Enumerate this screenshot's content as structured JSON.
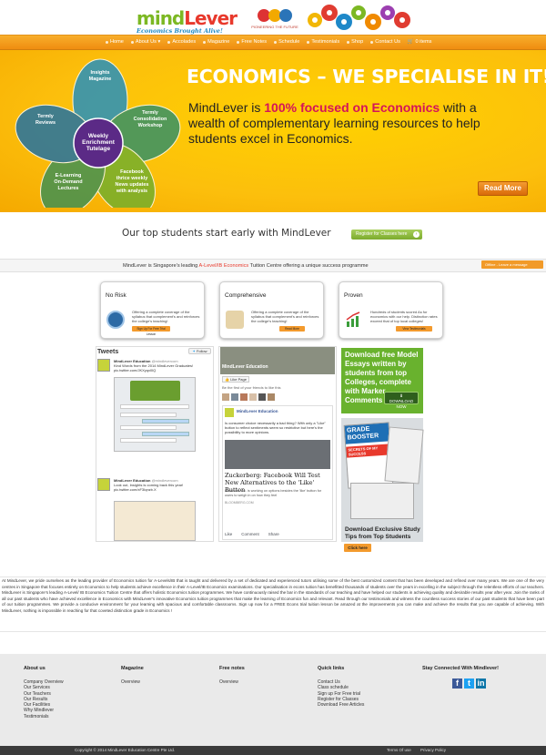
{
  "header": {
    "logo_mind": "mind",
    "logo_lever": "Lever",
    "logo_tagline": "Economics Brought Alive!",
    "sponsor_text": "PIONEERING THE FUTURE"
  },
  "nav": {
    "items": [
      "Home",
      "About Us",
      "Accolades",
      "Magazine",
      "Free Notes",
      "Schedule",
      "Testimonials",
      "Shop",
      "Contact Us",
      "0 items"
    ]
  },
  "hero": {
    "title": "ECONOMICS – WE SPECIALISE IN IT!",
    "body_pre": "MindLever is ",
    "body_highlight": "100% focused on Economics",
    "body_post": " with a wealth of complementary learning resources to help students excel in Economics.",
    "read_more": "Read More",
    "venn": {
      "center": "Weekly Enrichment Tutelage",
      "petals": [
        "Insights Magazine",
        "Termly Consolidation Workshop",
        "Facebook thrice weekly News updates with analysis",
        "E-Learning On-Demand Lectures",
        "Termly Reviews"
      ]
    }
  },
  "early": {
    "text": "Our top students start early with MindLever",
    "register": "Register for Classes here"
  },
  "leading": {
    "pre": "MindLever is Singapore's leading ",
    "highlight": "A-Level/IB Economics",
    "post": " Tuition Centre offering a unique success programme",
    "offline": "Offline - Leave a message"
  },
  "boxes": [
    {
      "title": "No Risk",
      "text": "Offering a complete coverage of the syllabus that complement's and reinforces the college's teaching!",
      "button": "Sign Up For Free Trial Lesson"
    },
    {
      "title": "Comprehensive",
      "text": "Offering a complete coverage of the syllabus that complement's and reinforces the college's teaching!",
      "button": "Read More"
    },
    {
      "title": "Proven",
      "text": "Hundreds of students scored As for economics with our help. Distinction rates exceed that of top local colleges!",
      "button": "View Testimonials"
    }
  ],
  "tweets": {
    "header": "Tweets",
    "follow": "Follow",
    "items": [
      {
        "author": "MindLever Education",
        "handle": "@mindlevercom",
        "text": "Kind Words from the 2014 MindLever Graduates! pic.twitter.com/JKXyqxl0Q"
      },
      {
        "author": "MindLever Education",
        "handle": "@mindlevercom",
        "text": "Look out, Insights is coming back this year! pic.twitter.com/xF3Iqnzb.X"
      }
    ]
  },
  "facebook": {
    "page": "MindLever Education",
    "like": "Like Page",
    "friends": "Be the first of your friends to like this",
    "post_text": "Is consumer choice necessarily a bad thing? With only a \"Like\" button to reflect sentiments seem so restrictive but here's the possibility to more opinions.",
    "article_title": "Zuckerberg: Facebook Will Test New Alternatives to the 'Like' Button",
    "article_text": "Facebook Inc. is working on options besides the 'like' button for users to weigh in on how they feel",
    "source": "BLOOMBERG.COM",
    "actions": [
      "Like",
      "Comment",
      "Share"
    ]
  },
  "promo": {
    "text": "Download free Model Essays written by students from top Colleges, complete with Marker Comments",
    "button": "DOWNLOAD NOW"
  },
  "grade": {
    "title": "GRADE BOOSTER",
    "subtitle": "SECRETS OF MY SUCCESS",
    "caption": "Download Exclusive Study Tips from Top Students",
    "click": "Click here"
  },
  "paragraph": "At MindLever, we pride ourselves as the leading provider of Economics tuition for A-Levels/IB that is taught and delivered by a set of dedicated and experienced tutors utilising some of the best customized content that has been developed and refined over many years. We are one of the very centres in Singapore that focuses entirely on Economics to help students achieve excellence in their A-Level/IB Economics examinations. Our specialisation in econs tuition has benefitted thousands of students over the years in excelling in the subject through the relentless efforts of our teachers. MindLever is Singapore's leading A-Level/ IB Economics Tuition Centre that offers holistic Economics tuition programmes. We have continuously raised the bar in the standards of our teaching and have helped our students in achieving quality and desirable results year after year. Join the ranks of all our past students who have achieved excellence in Economics with MindLever's innovative Economics tuition programmes that make the learning of Economics fun and relevant. Read through our testimonials and witness the countless success stories of our past students that have been part of our tuition programmes. We provide a conducive environment for your learning with spacious and comfortable classrooms. Sign up now for a FREE Econs trial tuition lesson be amazed at the improvements you can make and achieve the results that you are capable of achieving. With MindLever, nothing is impossible in reaching for that coveted distinction grade in Economics !",
  "footer": {
    "about": {
      "title": "About us",
      "items": [
        "Company Overview",
        "Our Services",
        "Our Teachers",
        "Our Results",
        "Our Facilities",
        "Why Mindlever",
        "Testimonials"
      ]
    },
    "magazine": {
      "title": "Magazine",
      "items": [
        "Overview"
      ]
    },
    "free_notes": {
      "title": "Free notes",
      "items": [
        "Overview"
      ]
    },
    "quick_links": {
      "title": "Quick links",
      "items": [
        "Contact Us",
        "Class schedule",
        "Sign up For Free trial",
        "Register for Classes",
        "Download Free Articles"
      ]
    },
    "stay": "Stay Connected With Mindlever!",
    "copyright": "Copyright © 2014 MindLever Education Centre Pte Ltd.",
    "terms": "Terms Of use",
    "privacy": "Privacy Policy"
  }
}
